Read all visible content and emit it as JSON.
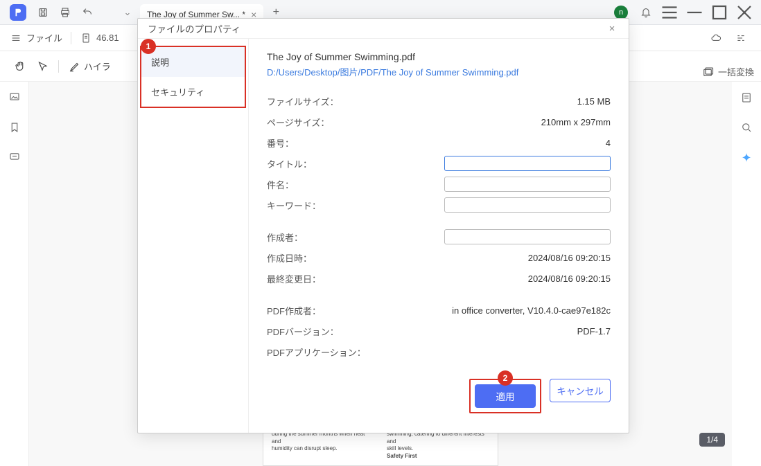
{
  "titlebar": {
    "tab": "The Joy of Summer Sw... *",
    "avatar": "n"
  },
  "bar2": {
    "file": "ファイル",
    "zoom": "46.81"
  },
  "toolbar": {
    "highlight": "ハイラ"
  },
  "convert": {
    "label": "一括変換"
  },
  "page_paper": {
    "l1": "during the summer months when heat and",
    "l2": "humidity can disrupt sleep.",
    "r1": "swimming, catering to different interests and",
    "r2": "skill levels.",
    "r3": "Safety First"
  },
  "page_indicator": "1/4",
  "dialog": {
    "title": "ファイルのプロパティ",
    "nav": {
      "description": "説明",
      "security": "セキュリティ"
    },
    "badges": {
      "one": "1",
      "two": "2"
    },
    "file": {
      "name": "The Joy of Summer Swimming.pdf",
      "path": "D:/Users/Desktop/图片/PDF/The Joy of Summer Swimming.pdf"
    },
    "props": {
      "filesize_label": "ファイルサイズ：",
      "filesize": "1.15 MB",
      "pagesize_label": "ページサイズ：",
      "pagesize": "210mm x 297mm",
      "pages_label": "番号：",
      "pages": "4",
      "title_label": "タイトル：",
      "title": "",
      "subject_label": "件名：",
      "subject": "",
      "keywords_label": "キーワード：",
      "keywords": "",
      "author_label": "作成者：",
      "author": "",
      "created_label": "作成日時：",
      "created": "2024/08/16 09:20:15",
      "modified_label": "最終変更日：",
      "modified": "2024/08/16 09:20:15",
      "producer_label": "PDF作成者：",
      "producer": "in office converter, V10.4.0-cae97e182c",
      "version_label": "PDFバージョン：",
      "version": "PDF-1.7",
      "application_label": "PDFアプリケーション：",
      "application": ""
    },
    "buttons": {
      "apply": "適用",
      "cancel": "キャンセル"
    }
  }
}
